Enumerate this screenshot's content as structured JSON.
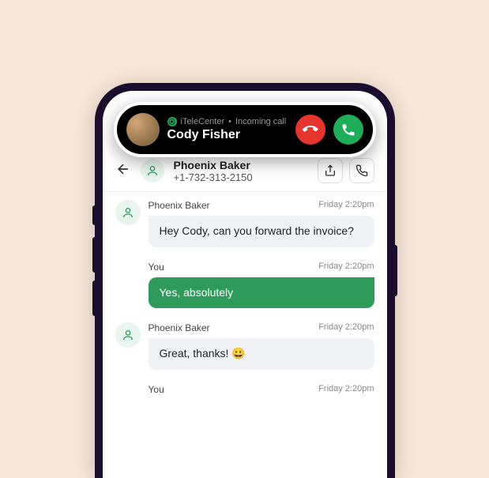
{
  "incoming_call": {
    "app_name": "iTeleCenter",
    "status": "Incoming call",
    "caller": "Cody Fisher"
  },
  "chat_header": {
    "contact_name": "Phoenix Baker",
    "phone": "+1-732-313-2150"
  },
  "messages": [
    {
      "sender": "Phoenix Baker",
      "time": "Friday 2:20pm",
      "text": "Hey Cody, can you forward the invoice?",
      "mine": false
    },
    {
      "sender": "You",
      "time": "Friday 2:20pm",
      "text": "Yes, absolutely",
      "mine": true
    },
    {
      "sender": "Phoenix Baker",
      "time": "Friday 2:20pm",
      "text": "Great, thanks! 😀",
      "mine": false
    },
    {
      "sender": "You",
      "time": "Friday 2:20pm",
      "text": "",
      "mine": true
    }
  ]
}
